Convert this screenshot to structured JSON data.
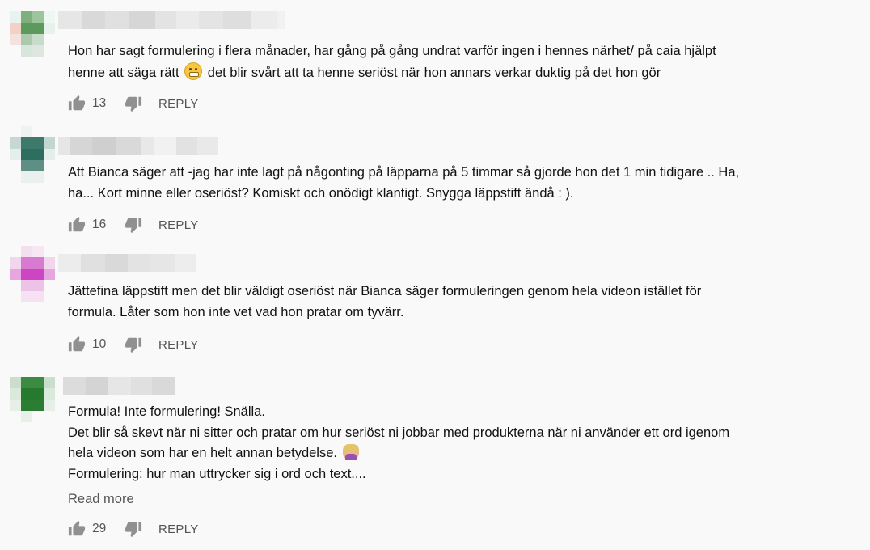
{
  "comments": [
    {
      "lines": [
        "Hon har sagt formulering i flera månader, har gång på gång undrat varför ingen i hennes närhet/ på caia hjälpt"
      ],
      "line2_before": "henne att säga rätt ",
      "line2_emoji": "grimace-emoji",
      "line2_after": " det blir svårt att ta henne seriöst när hon annars verkar duktig på det hon gör",
      "likes": "13",
      "reply_label": "REPLY"
    },
    {
      "text": "Att Bianca säger att -jag har inte lagt på någonting på läpparna på 5 timmar så gjorde hon det 1 min tidigare .. Ha,\nha... Kort minne eller oseriöst? Komiskt och onödigt klantigt. Snygga läppstift ändå : ).",
      "likes": "16",
      "reply_label": "REPLY"
    },
    {
      "text": "Jättefina läppstift men det blir väldigt oseriöst när Bianca säger formuleringen genom hela videon istället för\nformula. Låter som hon inte vet vad hon pratar om tyvärr.",
      "likes": "10",
      "reply_label": "REPLY"
    },
    {
      "text_a": "Formula! Inte formulering! Snälla.\nDet blir så skevt när ni sitter och pratar om hur seriöst ni jobbar med produkterna när ni använder ett ord igenom\nhela videon som har en helt annan betydelse. ",
      "emoji": "facepalm-emoji",
      "text_b": "\nFormulering: hur man uttrycker sig i ord och text....",
      "read_more": "Read more",
      "likes": "29",
      "reply_label": "REPLY"
    }
  ],
  "colors": {
    "background": "#f9f9f9",
    "text": "#111111",
    "secondary": "#555555",
    "icon": "#909090"
  }
}
